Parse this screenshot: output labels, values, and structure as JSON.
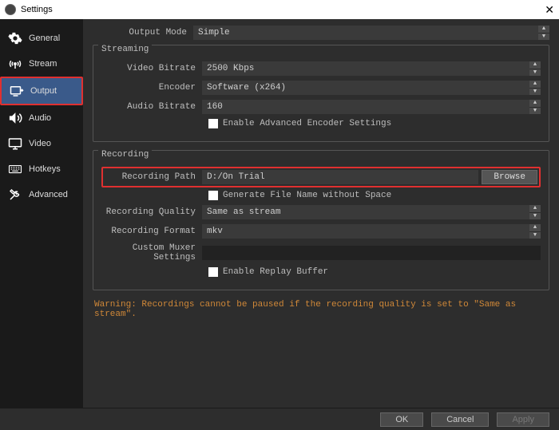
{
  "title": "Settings",
  "sidebar": {
    "items": [
      {
        "label": "General"
      },
      {
        "label": "Stream"
      },
      {
        "label": "Output"
      },
      {
        "label": "Audio"
      },
      {
        "label": "Video"
      },
      {
        "label": "Hotkeys"
      },
      {
        "label": "Advanced"
      }
    ]
  },
  "output_mode": {
    "label": "Output Mode",
    "value": "Simple"
  },
  "streaming": {
    "title": "Streaming",
    "video_bitrate": {
      "label": "Video Bitrate",
      "value": "2500 Kbps"
    },
    "encoder": {
      "label": "Encoder",
      "value": "Software (x264)"
    },
    "audio_bitrate": {
      "label": "Audio Bitrate",
      "value": "160"
    },
    "advanced_cb": {
      "label": "Enable Advanced Encoder Settings"
    }
  },
  "recording": {
    "title": "Recording",
    "path": {
      "label": "Recording Path",
      "value": "D:/On Trial",
      "browse": "Browse"
    },
    "gen_filename_cb": {
      "label": "Generate File Name without Space"
    },
    "quality": {
      "label": "Recording Quality",
      "value": "Same as stream"
    },
    "format": {
      "label": "Recording Format",
      "value": "mkv"
    },
    "muxer": {
      "label": "Custom Muxer Settings",
      "value": ""
    },
    "replay_cb": {
      "label": "Enable Replay Buffer"
    }
  },
  "warning": "Warning: Recordings cannot be paused if the recording quality is set to \"Same as stream\".",
  "footer": {
    "ok": "OK",
    "cancel": "Cancel",
    "apply": "Apply"
  }
}
